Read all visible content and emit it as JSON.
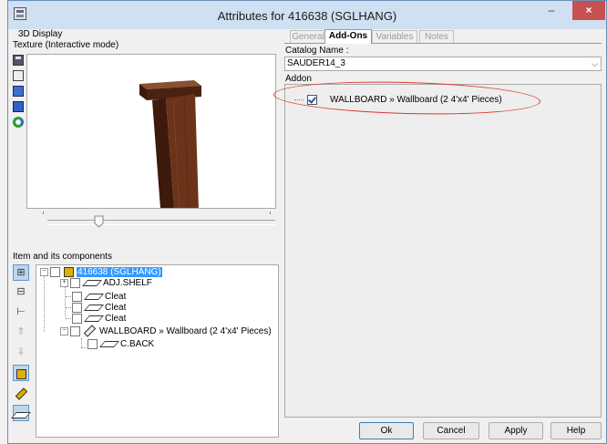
{
  "window": {
    "title": "Attributes for 416638 (SGLHANG)",
    "min_glyph": "–",
    "max_glyph": "□",
    "close_glyph": "×"
  },
  "left_panel": {
    "display_label": "3D Display",
    "texture_label": "Texture (Interactive mode)",
    "tool_icons": [
      "save-icon",
      "print-icon",
      "monitor-icon",
      "monitor-color-icon",
      "refresh-icon"
    ]
  },
  "tree_panel": {
    "label": "Item and its components",
    "tool_icons": [
      "expand-all-icon",
      "collapse-all-icon",
      "hierarchy-icon",
      "move-up-icon",
      "move-down-icon",
      "box-icon",
      "panel-icon",
      "shelf-icon"
    ],
    "nodes": [
      {
        "label": "416638 (SGLHANG)",
        "selected": true
      },
      {
        "label": "ADJ.SHELF"
      },
      {
        "label": "Cleat"
      },
      {
        "label": "Cleat"
      },
      {
        "label": "Cleat"
      },
      {
        "label": "WALLBOARD » Wallboard (2 4'x4' Pieces)"
      },
      {
        "label": "C.BACK"
      }
    ]
  },
  "right_panel": {
    "tabs": [
      "General",
      "Add-Ons",
      "Variables",
      "Notes"
    ],
    "active_tab": "Add-Ons",
    "catalog_label": "Catalog Name :",
    "catalog_value": "SAUDER14_3",
    "addon_label": "Addon",
    "addons": [
      {
        "label": "WALLBOARD » Wallboard (2 4'x4' Pieces)",
        "checked": true
      }
    ]
  },
  "buttons": {
    "ok": "Ok",
    "cancel": "Cancel",
    "apply": "Apply",
    "help": "Help"
  },
  "colors": {
    "title_bar": "#cfe0f2",
    "close_button": "#c75050",
    "selection": "#3399ff",
    "highlight_ellipse": "#d93a2e",
    "wood": "#5a2a14"
  }
}
